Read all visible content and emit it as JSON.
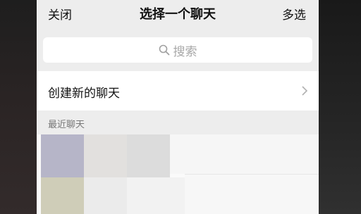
{
  "nav": {
    "close_label": "关闭",
    "title": "选择一个聊天",
    "multi_select_label": "多选"
  },
  "search": {
    "placeholder": "搜索",
    "icon": "search-icon"
  },
  "create_chat": {
    "label": "创建新的聊天",
    "icon": "chevron-right-icon"
  },
  "recent": {
    "section_title": "最近聊天"
  },
  "colors": {
    "sheet_background": "#ededed",
    "row_background": "#ffffff",
    "placeholder_text": "#a8a8a8",
    "section_text": "#777777"
  }
}
